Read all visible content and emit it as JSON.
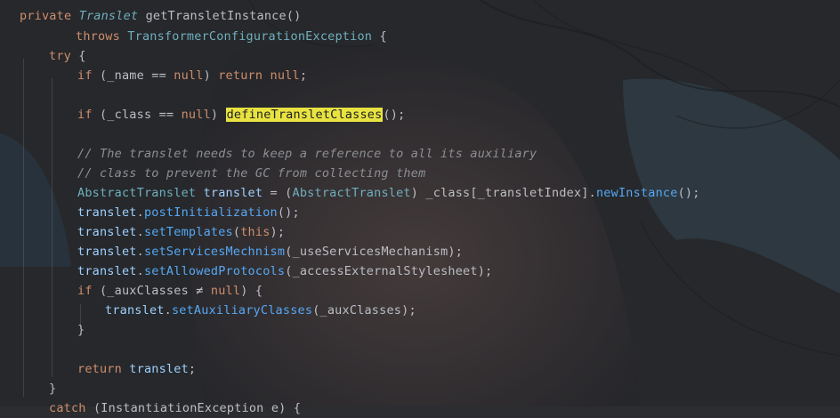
{
  "editor": {
    "lines": [
      [
        {
          "t": "private ",
          "c": "kw"
        },
        {
          "t": "Translet",
          "c": "itype"
        },
        {
          "t": " ",
          "c": "pl"
        },
        {
          "t": "getTransletInstance",
          "c": "pl"
        },
        {
          "t": "()",
          "c": "pl"
        }
      ],
      [
        {
          "t": "throws ",
          "c": "kw"
        },
        {
          "t": "TransformerConfigurationException",
          "c": "type"
        },
        {
          "t": " {",
          "c": "pl"
        }
      ],
      [
        {
          "t": "try",
          "c": "kw"
        },
        {
          "t": " {",
          "c": "pl"
        }
      ],
      [
        {
          "t": "if",
          "c": "kw"
        },
        {
          "t": " (_name ",
          "c": "pl"
        },
        {
          "t": "==",
          "c": "pl"
        },
        {
          "t": " ",
          "c": "pl"
        },
        {
          "t": "null",
          "c": "kw"
        },
        {
          "t": ") ",
          "c": "pl"
        },
        {
          "t": "return",
          "c": "kw"
        },
        {
          "t": " ",
          "c": "pl"
        },
        {
          "t": "null",
          "c": "kw"
        },
        {
          "t": ";",
          "c": "pl"
        }
      ],
      [],
      [
        {
          "t": "if",
          "c": "kw"
        },
        {
          "t": " (_class ",
          "c": "pl"
        },
        {
          "t": "==",
          "c": "pl"
        },
        {
          "t": " ",
          "c": "pl"
        },
        {
          "t": "null",
          "c": "kw"
        },
        {
          "t": ") ",
          "c": "pl"
        },
        {
          "t": "defineTransletClasses",
          "c": "hl"
        },
        {
          "t": "();",
          "c": "pl"
        }
      ],
      [],
      [
        {
          "t": "// The translet needs to keep a reference to all its auxiliary",
          "c": "cm"
        }
      ],
      [
        {
          "t": "// class to prevent the GC from collecting them",
          "c": "cm"
        }
      ],
      [
        {
          "t": "AbstractTranslet",
          "c": "type"
        },
        {
          "t": " ",
          "c": "pl"
        },
        {
          "t": "translet",
          "c": "var"
        },
        {
          "t": " = (",
          "c": "pl"
        },
        {
          "t": "AbstractTranslet",
          "c": "type"
        },
        {
          "t": ") _class[_transletIndex].",
          "c": "pl"
        },
        {
          "t": "newInstance",
          "c": "method"
        },
        {
          "t": "();",
          "c": "pl"
        }
      ],
      [
        {
          "t": "translet",
          "c": "var"
        },
        {
          "t": ".",
          "c": "pl"
        },
        {
          "t": "postInitialization",
          "c": "method"
        },
        {
          "t": "();",
          "c": "pl"
        }
      ],
      [
        {
          "t": "translet",
          "c": "var"
        },
        {
          "t": ".",
          "c": "pl"
        },
        {
          "t": "setTemplates",
          "c": "method"
        },
        {
          "t": "(",
          "c": "pl"
        },
        {
          "t": "this",
          "c": "kw"
        },
        {
          "t": ");",
          "c": "pl"
        }
      ],
      [
        {
          "t": "translet",
          "c": "var"
        },
        {
          "t": ".",
          "c": "pl"
        },
        {
          "t": "setServicesMechnism",
          "c": "method"
        },
        {
          "t": "(_useServicesMechanism);",
          "c": "pl"
        }
      ],
      [
        {
          "t": "translet",
          "c": "var"
        },
        {
          "t": ".",
          "c": "pl"
        },
        {
          "t": "setAllowedProtocols",
          "c": "method"
        },
        {
          "t": "(_accessExternalStylesheet);",
          "c": "pl"
        }
      ],
      [
        {
          "t": "if",
          "c": "kw"
        },
        {
          "t": " (_auxClasses ",
          "c": "pl"
        },
        {
          "t": "≠",
          "c": "pl"
        },
        {
          "t": " ",
          "c": "pl"
        },
        {
          "t": "null",
          "c": "kw"
        },
        {
          "t": ") {",
          "c": "pl"
        }
      ],
      [
        {
          "t": "translet",
          "c": "var"
        },
        {
          "t": ".",
          "c": "pl"
        },
        {
          "t": "setAuxiliaryClasses",
          "c": "method"
        },
        {
          "t": "(_auxClasses);",
          "c": "pl"
        }
      ],
      [
        {
          "t": "}",
          "c": "pl"
        }
      ],
      [],
      [
        {
          "t": "return",
          "c": "kw"
        },
        {
          "t": " ",
          "c": "pl"
        },
        {
          "t": "translet",
          "c": "var"
        },
        {
          "t": ";",
          "c": "pl"
        }
      ],
      [
        {
          "t": "}",
          "c": "pl"
        }
      ],
      [
        {
          "t": "catch",
          "c": "kw"
        },
        {
          "t": " (InstantiationException e) {",
          "c": "pl"
        }
      ]
    ],
    "highlight_color": "#e8e341",
    "background_color": "#2b2d30"
  }
}
